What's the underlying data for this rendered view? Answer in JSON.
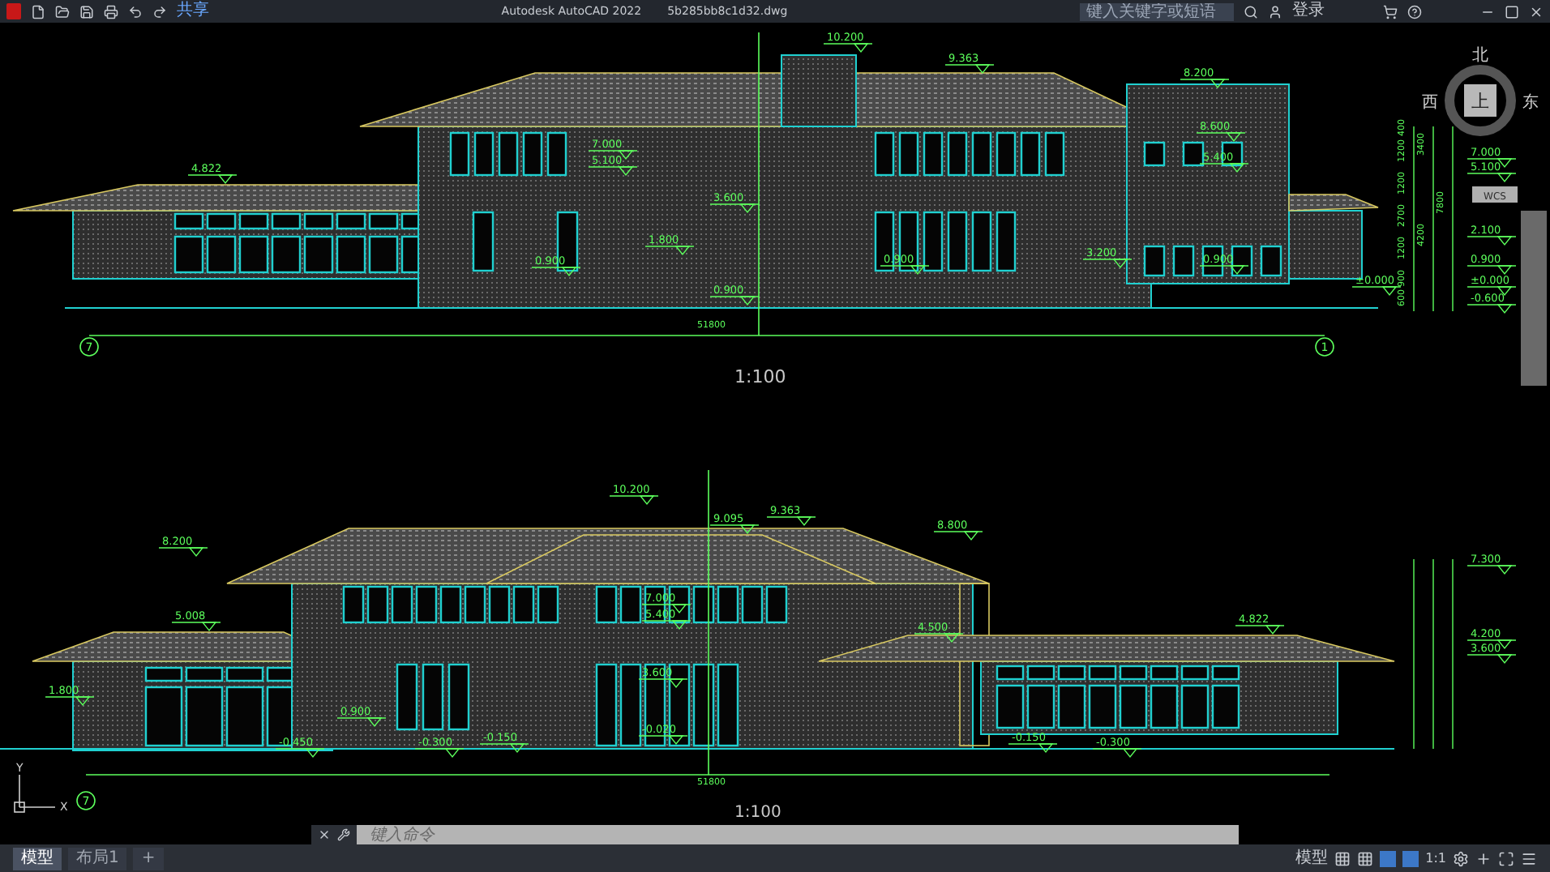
{
  "title_bar": {
    "app_title": "Autodesk AutoCAD 2022",
    "file_name": "5b285bb8c1d32.dwg",
    "share": "共享",
    "search_placeholder": "键入关键字或短语",
    "sign_in": "登录"
  },
  "viewcube": {
    "north": "北",
    "west": "西",
    "east": "东",
    "top": "上",
    "wcs": "WCS"
  },
  "elevations": [
    {
      "scale": "1:100",
      "total_dimension": "51800",
      "axes": [
        "7",
        "1"
      ],
      "levels": [
        "4.822",
        "7.000",
        "5.100",
        "3.600",
        "1.800",
        "0.900",
        "0.900",
        "10.200",
        "9.363",
        "8.200",
        "8.600",
        "5.400",
        "3.200",
        "0.900",
        "0.900"
      ]
    },
    {
      "scale": "1:100",
      "total_dimension": "51800",
      "axes": [
        "7"
      ],
      "levels": [
        "10.200",
        "9.363",
        "9.095",
        "8.200",
        "8.800",
        "5.008",
        "7.000",
        "5.400",
        "4.500",
        "4.822",
        "3.600",
        "1.800",
        "0.900",
        "-0.450",
        "-0.300",
        "-0.150",
        "-0.020",
        "-0.150",
        "-0.300"
      ]
    }
  ],
  "right_dimensions": {
    "levels": [
      "7.000",
      "5.100",
      "2.100",
      "0.900",
      "±0.000",
      "±0.000",
      "-0.600",
      "7.300",
      "4.200",
      "3.600"
    ],
    "dims": [
      "400",
      "1200",
      "1200",
      "2700",
      "1200",
      "900",
      "600",
      "3400",
      "7800",
      "4200"
    ]
  },
  "ucs": {
    "y": "Y",
    "x": "X"
  },
  "command_line": {
    "placeholder": "键入命令"
  },
  "layout_tabs": [
    {
      "label": "模型",
      "selected": true
    },
    {
      "label": "布局1",
      "selected": false
    },
    {
      "label": "+",
      "selected": false
    }
  ],
  "status_bar": {
    "space": "模型",
    "scale": "1:1"
  }
}
